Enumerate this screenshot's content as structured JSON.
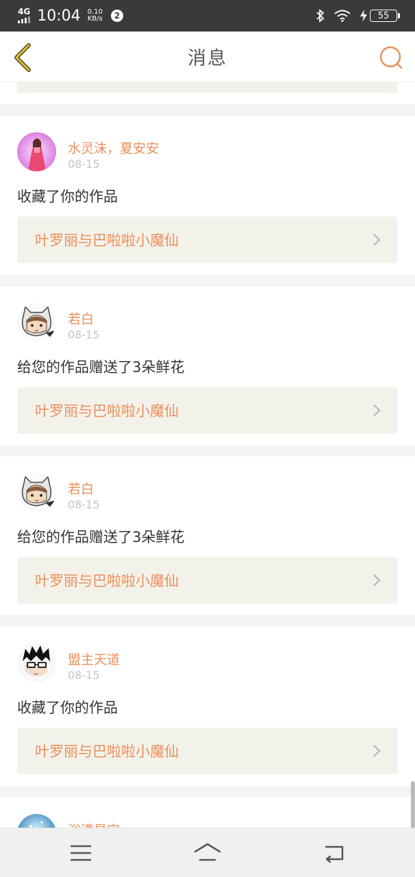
{
  "status_bar": {
    "network": "4G",
    "time": "10:04",
    "speed_value": "0.10",
    "speed_unit": "KB/s",
    "notification_count": "2",
    "battery": "55"
  },
  "header": {
    "title": "消息"
  },
  "colors": {
    "accent": "#ea8f5a",
    "link_bg": "#f3f2ea",
    "date": "#c4c4c4"
  },
  "messages": [
    {
      "user": "水灵沫，夏安安",
      "date": "08-15",
      "text": "收藏了你的作品",
      "work": "叶罗丽与巴啦啦小魔仙",
      "avatar": "girl-avatar-icon"
    },
    {
      "user": "若白",
      "date": "08-15",
      "text": "给您的作品赠送了3朵鲜花",
      "work": "叶罗丽与巴啦啦小魔仙",
      "avatar": "cat-hood-avatar-icon"
    },
    {
      "user": "若白",
      "date": "08-15",
      "text": "给您的作品赠送了3朵鲜花",
      "work": "叶罗丽与巴啦啦小魔仙",
      "avatar": "cat-hood-avatar-icon"
    },
    {
      "user": "盟主天道",
      "date": "08-15",
      "text": "收藏了你的作品",
      "work": "叶罗丽与巴啦啦小魔仙",
      "avatar": "glasses-boy-avatar-icon"
    }
  ],
  "partial_message": {
    "user": "浴漕星空",
    "avatar": "starry-avatar-icon"
  },
  "nav": {
    "menu_icon": "menu-icon",
    "home_icon": "home-icon",
    "back_icon": "return-icon"
  }
}
